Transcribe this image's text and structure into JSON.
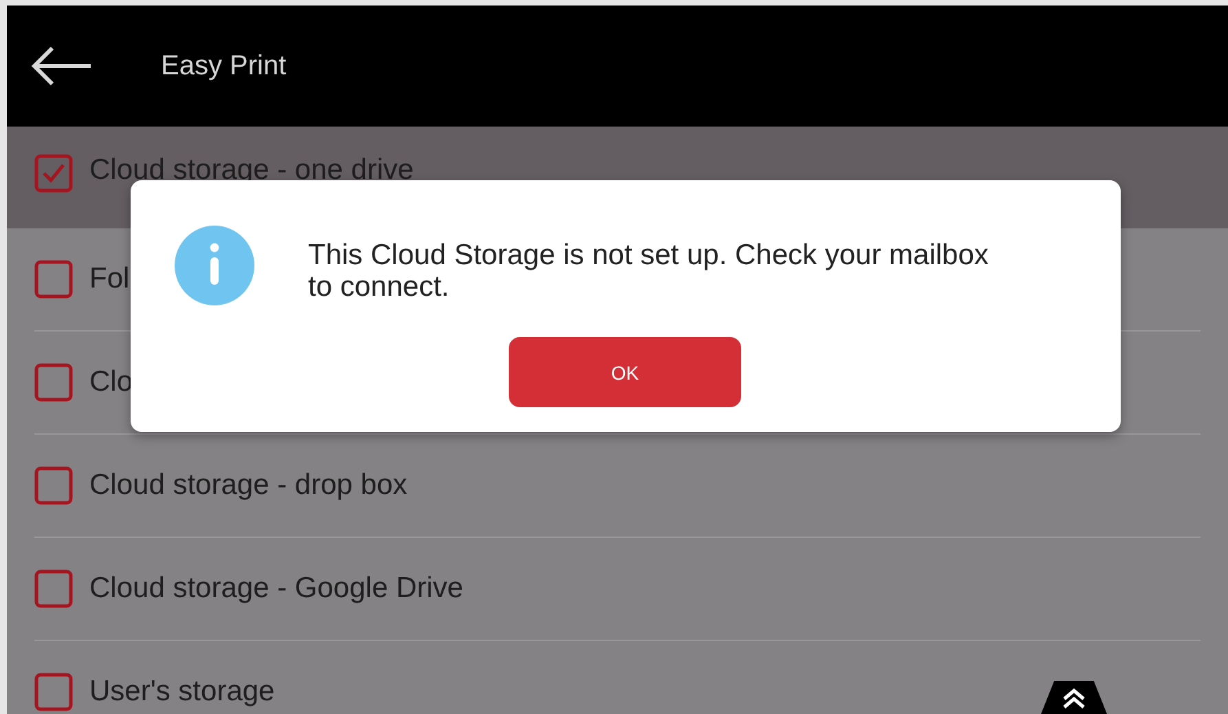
{
  "header": {
    "title": "Easy Print"
  },
  "items": [
    {
      "label": "Cloud storage - one drive",
      "checked": true,
      "selected": true
    },
    {
      "label": "Fol",
      "checked": false,
      "selected": false
    },
    {
      "label": "Clo",
      "checked": false,
      "selected": false
    },
    {
      "label": "Cloud storage - drop box",
      "checked": false,
      "selected": false
    },
    {
      "label": "Cloud storage - Google Drive",
      "checked": false,
      "selected": false
    },
    {
      "label": "User's storage",
      "checked": false,
      "selected": false
    }
  ],
  "dialog": {
    "message": "This Cloud Storage is not set up. Check your mailbox to connect.",
    "button": "OK"
  }
}
